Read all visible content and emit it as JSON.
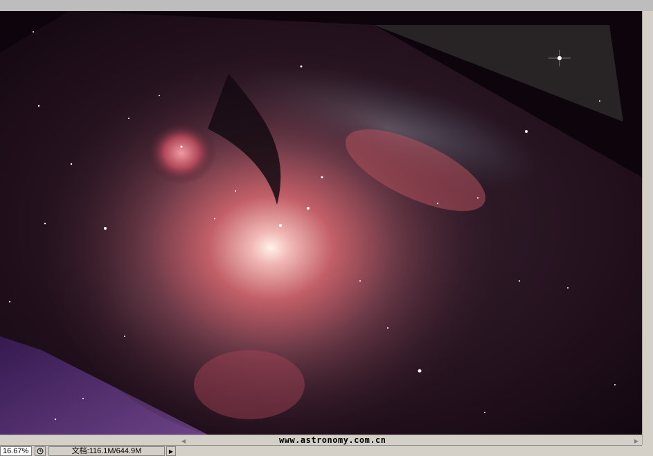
{
  "status": {
    "zoom": "16.67%",
    "doc_info": "文档:116.1M/644.9M",
    "watermark": "www.astronomy.com.cn"
  },
  "icons": {
    "status_menu": "clock-icon",
    "doc_arrow": "triangle-right-icon",
    "scroll_left": "triangle-left-icon",
    "scroll_right": "triangle-right-icon"
  },
  "colors": {
    "nebula_core": "#f5dede",
    "nebula_red": "#c8505a",
    "nebula_blue": "#7a8a9e",
    "background": "#1a0a14"
  }
}
